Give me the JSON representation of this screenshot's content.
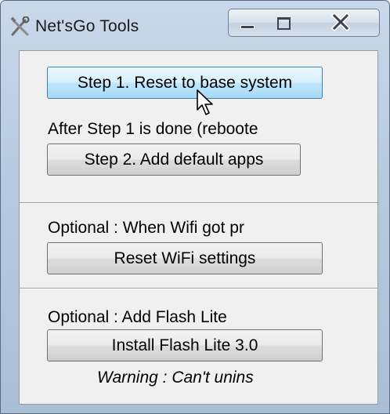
{
  "window": {
    "title": "Net'sGo Tools",
    "icon": "tools-icon"
  },
  "caption_buttons": {
    "minimize_icon": "minimize-icon",
    "maximize_icon": "maximize-icon",
    "close_icon": "close-icon"
  },
  "step1": {
    "button_label": "Step 1. Reset to base system",
    "note": "After Step 1 is done (reboote"
  },
  "step2": {
    "button_label": "Step 2. Add  default apps"
  },
  "wifi": {
    "caption": "Optional : When Wifi got pr",
    "button_label": "Reset WiFi settings"
  },
  "flash": {
    "caption": "Optional : Add Flash Lite",
    "button_label": "Install Flash Lite 3.0",
    "warning": "Warning : Can't unins"
  },
  "colors": {
    "hover_button_border": "#3c7fb1",
    "hover_button_fill": "#bee6fd",
    "window_frame": "#b9cbe0"
  },
  "cursor": "mouse-pointer-icon"
}
